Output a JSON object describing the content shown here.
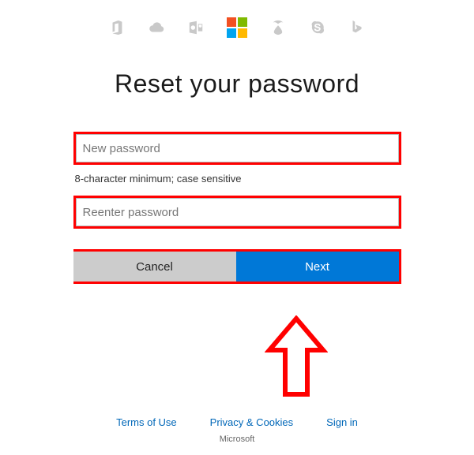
{
  "header": {
    "icons": [
      "office-icon",
      "onedrive-icon",
      "outlook-icon",
      "microsoft-logo",
      "xbox-icon",
      "skype-icon",
      "bing-icon"
    ]
  },
  "page": {
    "title": "Reset your password"
  },
  "form": {
    "new_password": {
      "value": "",
      "placeholder": "New password"
    },
    "hint": "8-character minimum; case sensitive",
    "reenter_password": {
      "value": "",
      "placeholder": "Reenter password"
    },
    "buttons": {
      "cancel": "Cancel",
      "next": "Next"
    }
  },
  "annotations": {
    "arrow_target": "next-button",
    "highlight_boxes": [
      "new-password-input",
      "reenter-password-input",
      "next-button"
    ]
  },
  "footer": {
    "links": {
      "terms": "Terms of Use",
      "privacy": "Privacy & Cookies",
      "sign_in": "Sign in"
    },
    "brand": "Microsoft"
  }
}
